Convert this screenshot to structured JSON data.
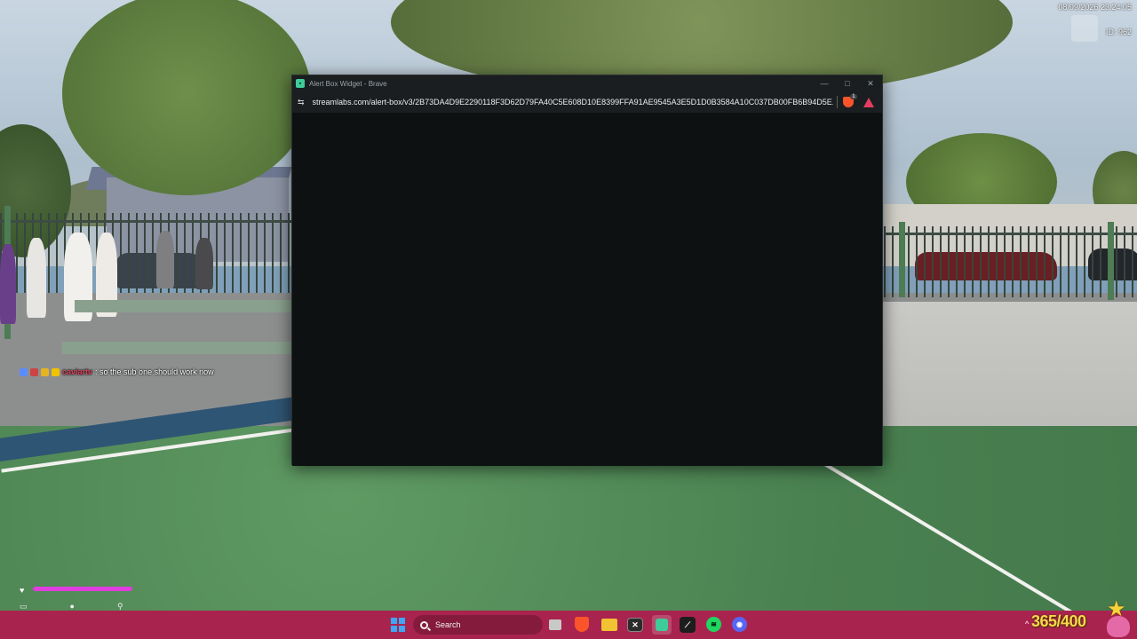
{
  "hud": {
    "datetime": "08/09/2026 23:24:05",
    "player_id": "ID: 962",
    "score": "365/400",
    "chat": {
      "username": "caviartv",
      "message": ": so the sub one should work now"
    }
  },
  "window": {
    "title": "Alert Box Widget - Brave",
    "url": "streamlabs.com/alert-box/v3/2B73DA4D9E2290118F3D62D79FA40C5E608D10E8399FFA91AE9545A3E5D1D0B3584A10C037DB00FB6B94D5E...",
    "controls": {
      "minimize": "—",
      "maximize": "□",
      "close": "✕"
    },
    "shield_count": "1"
  },
  "taskbar": {
    "search_placeholder": "Search",
    "apps": [
      "task-view",
      "brave",
      "file-explorer",
      "terminal",
      "streamlabs",
      "obs",
      "spotify",
      "discord"
    ]
  },
  "colors": {
    "taskbar": "#a9234f",
    "window_bg": "#0d1112",
    "health": "#e03ce0",
    "score": "#f8d64d"
  }
}
